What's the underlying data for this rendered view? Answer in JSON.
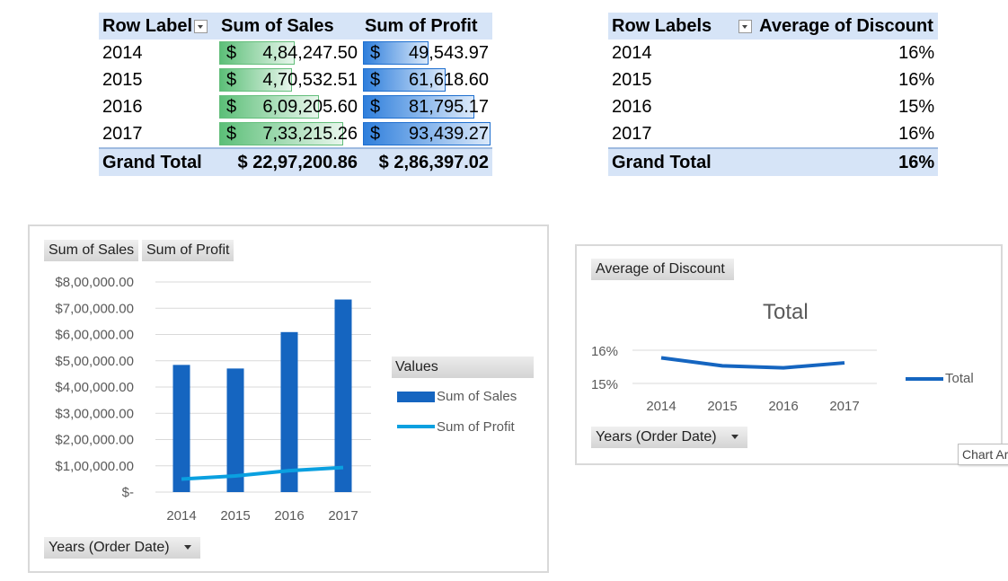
{
  "pivot_sales_profit": {
    "header": {
      "row_label": "Row Label",
      "sales": "Sum of Sales",
      "profit": "Sum of Profit"
    },
    "rows": [
      {
        "year": "2014",
        "sales_sym": "$",
        "sales": "4,84,247.50",
        "profit_sym": "$",
        "profit": "49,543.97",
        "sales_value": 484247.5,
        "profit_value": 49543.97
      },
      {
        "year": "2015",
        "sales_sym": "$",
        "sales": "4,70,532.51",
        "profit_sym": "$",
        "profit": "61,618.60",
        "sales_value": 470532.51,
        "profit_value": 61618.6
      },
      {
        "year": "2016",
        "sales_sym": "$",
        "sales": "6,09,205.60",
        "profit_sym": "$",
        "profit": "81,795.17",
        "sales_value": 609205.6,
        "profit_value": 81795.17
      },
      {
        "year": "2017",
        "sales_sym": "$",
        "sales": "7,33,215.26",
        "profit_sym": "$",
        "profit": "93,439.27",
        "sales_value": 733215.26,
        "profit_value": 93439.27
      }
    ],
    "total": {
      "label": "Grand Total",
      "sales": "$ 22,97,200.86",
      "profit": "$ 2,86,397.02"
    },
    "colors": {
      "sales_bar": "#63be7b",
      "profit_bar": "#1f6fcf"
    }
  },
  "pivot_discount": {
    "header": {
      "row_label": "Row Labels",
      "discount": "Average of Discount"
    },
    "rows": [
      {
        "year": "2014",
        "discount": "16%"
      },
      {
        "year": "2015",
        "discount": "16%"
      },
      {
        "year": "2016",
        "discount": "15%"
      },
      {
        "year": "2017",
        "discount": "16%"
      }
    ],
    "total": {
      "label": "Grand Total",
      "discount": "16%"
    }
  },
  "chart_sales": {
    "field_buttons": [
      "Sum of Sales",
      "Sum of Profit"
    ],
    "axis_field_button": "Years (Order Date)",
    "legend_title": "Values",
    "colors": {
      "sales": "#1565c0",
      "profit": "#0aa0e0"
    }
  },
  "chart_discount": {
    "field_button": "Average of Discount",
    "axis_field_button": "Years (Order Date)",
    "title": "Total",
    "colors": {
      "total": "#1565c0"
    }
  },
  "tooltip": {
    "text": "Chart Area"
  },
  "chart_data": [
    {
      "type": "bar",
      "categories": [
        "2014",
        "2015",
        "2016",
        "2017"
      ],
      "series": [
        {
          "name": "Sum of Sales",
          "type": "bar",
          "values": [
            484247.5,
            470532.51,
            609205.6,
            733215.26
          ]
        },
        {
          "name": "Sum of Profit",
          "type": "line",
          "values": [
            49543.97,
            61618.6,
            81795.17,
            93439.27
          ]
        }
      ],
      "y_tick_labels": [
        "$-",
        "$1,00,000.00",
        "$2,00,000.00",
        "$3,00,000.00",
        "$4,00,000.00",
        "$5,00,000.00",
        "$6,00,000.00",
        "$7,00,000.00",
        "$8,00,000.00"
      ],
      "ylim": [
        0,
        800000
      ],
      "grid": true,
      "legend": "right"
    },
    {
      "type": "line",
      "title": "Total",
      "categories": [
        "2014",
        "2015",
        "2016",
        "2017"
      ],
      "series": [
        {
          "name": "Total",
          "values": [
            0.1577,
            0.1553,
            0.1547,
            0.1562
          ]
        }
      ],
      "y_tick_labels": [
        "15%",
        "16%"
      ],
      "ylim": [
        0.15,
        0.16
      ],
      "grid": true,
      "legend": "right"
    }
  ]
}
